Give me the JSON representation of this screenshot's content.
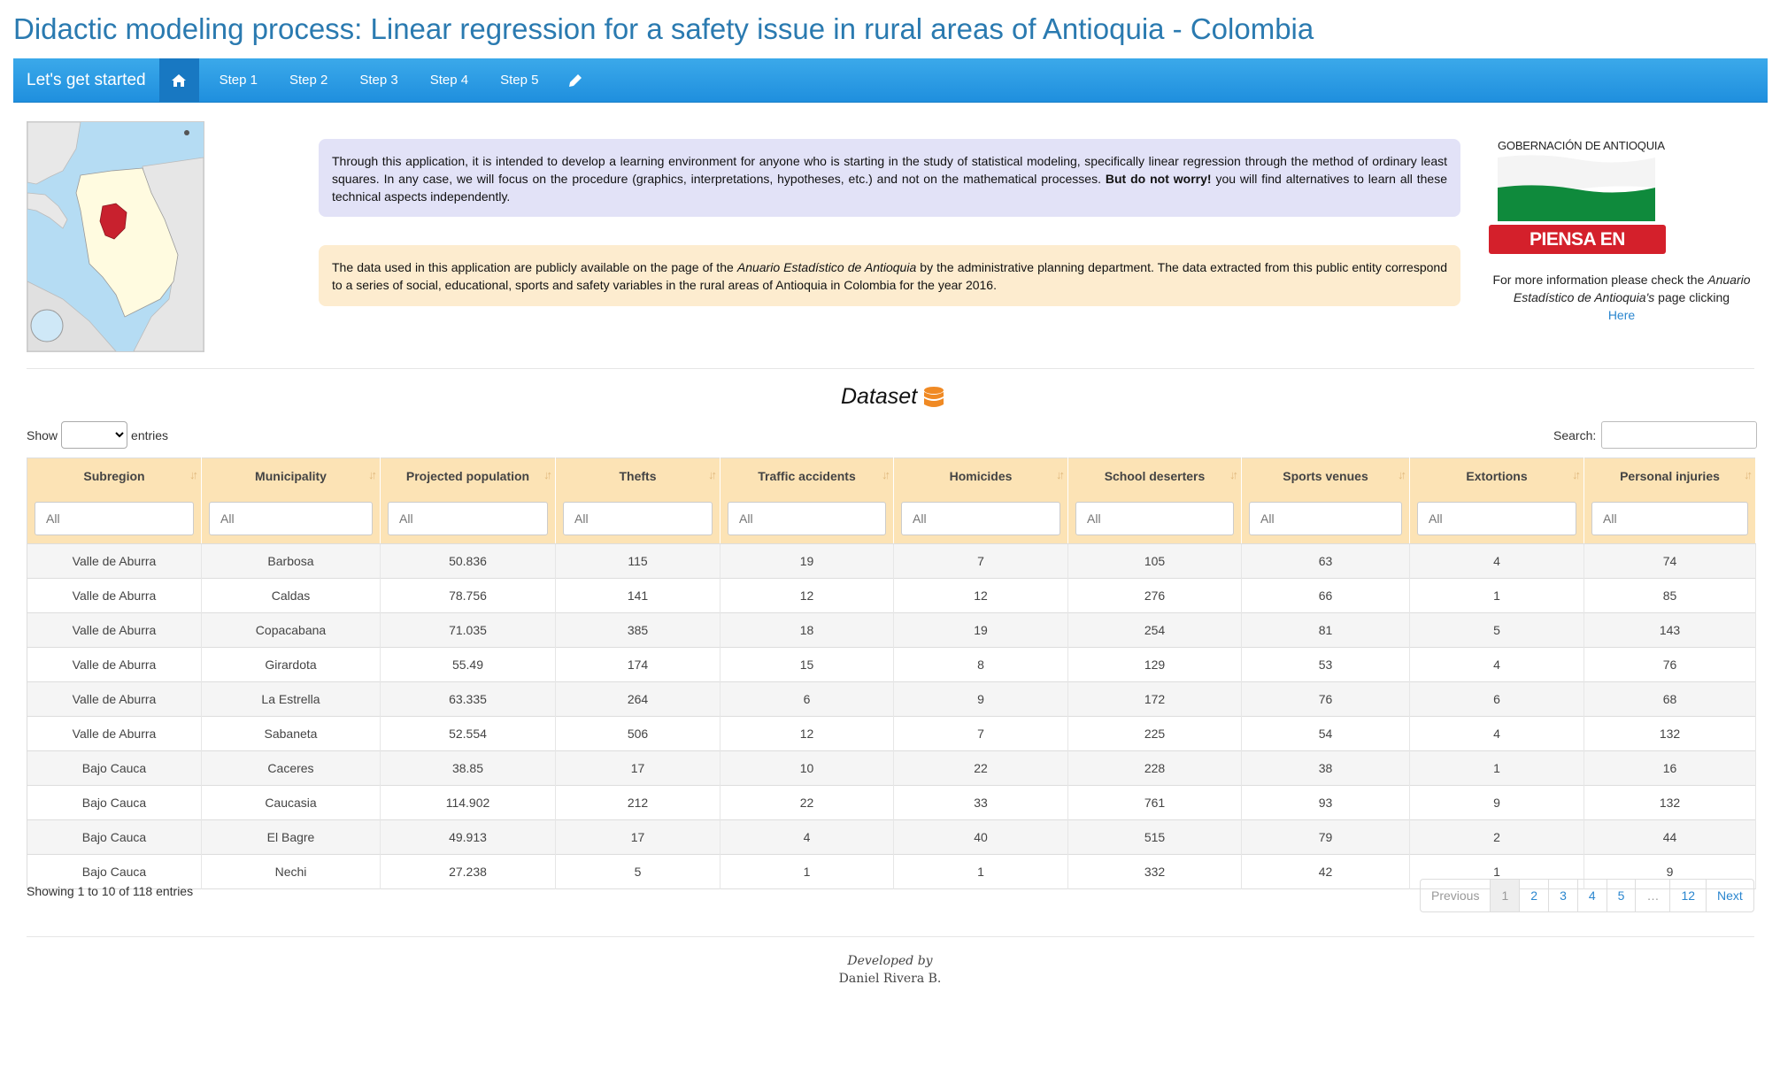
{
  "title": "Didactic modeling process: Linear regression for a safety issue in rural areas of Antioquia - Colombia",
  "navbar": {
    "brand": "Let's get started",
    "items": [
      "Step 1",
      "Step 2",
      "Step 3",
      "Step 4",
      "Step 5"
    ],
    "home_icon": "home-icon",
    "edit_icon": "pencil-icon",
    "color": "#2196e8"
  },
  "intro": {
    "p1_start": "Through this application, it is intended to develop a learning environment for anyone who is starting in the study of statistical modeling, specifically linear regression through the method of ordinary least squares. In any case, we will focus on the procedure (graphics, interpretations, hypotheses, etc.) and not on the mathematical processes. ",
    "p1_bold": "But do not worry!",
    "p1_end": " you will find alternatives to learn all these technical aspects independently.",
    "p2_start": "The data used in this application are publicly available on the page of the ",
    "p2_italic": "Anuario Estadístico de Antioquia",
    "p2_end": " by the administrative planning department. The data extracted from this public entity correspond to a series of social, educational, sports and safety variables in the rural areas of Antioquia in Colombia for the year 2016."
  },
  "logo": {
    "title": "GOBERNACIÓN DE ANTIOQUIA",
    "badge": "PIENSA EN GRANDE"
  },
  "info": {
    "start": "For more information please check the ",
    "italic": "Anuario Estadístico de Antioquia's",
    "end": " page clicking",
    "link": "Here"
  },
  "dataset": {
    "title": "Dataset",
    "icon": "database-icon",
    "show_label": "Show",
    "entries_label": "entries",
    "search_label": "Search:",
    "filter_placeholder": "All",
    "columns": [
      "Subregion",
      "Municipality",
      "Projected population",
      "Thefts",
      "Traffic accidents",
      "Homicides",
      "School deserters",
      "Sports venues",
      "Extortions",
      "Personal injuries"
    ],
    "rows": [
      [
        "Valle de Aburra",
        "Barbosa",
        "50.836",
        "115",
        "19",
        "7",
        "105",
        "63",
        "4",
        "74"
      ],
      [
        "Valle de Aburra",
        "Caldas",
        "78.756",
        "141",
        "12",
        "12",
        "276",
        "66",
        "1",
        "85"
      ],
      [
        "Valle de Aburra",
        "Copacabana",
        "71.035",
        "385",
        "18",
        "19",
        "254",
        "81",
        "5",
        "143"
      ],
      [
        "Valle de Aburra",
        "Girardota",
        "55.49",
        "174",
        "15",
        "8",
        "129",
        "53",
        "4",
        "76"
      ],
      [
        "Valle de Aburra",
        "La Estrella",
        "63.335",
        "264",
        "6",
        "9",
        "172",
        "76",
        "6",
        "68"
      ],
      [
        "Valle de Aburra",
        "Sabaneta",
        "52.554",
        "506",
        "12",
        "7",
        "225",
        "54",
        "4",
        "132"
      ],
      [
        "Bajo Cauca",
        "Caceres",
        "38.85",
        "17",
        "10",
        "22",
        "228",
        "38",
        "1",
        "16"
      ],
      [
        "Bajo Cauca",
        "Caucasia",
        "114.902",
        "212",
        "22",
        "33",
        "761",
        "93",
        "9",
        "132"
      ],
      [
        "Bajo Cauca",
        "El Bagre",
        "49.913",
        "17",
        "4",
        "40",
        "515",
        "79",
        "2",
        "44"
      ],
      [
        "Bajo Cauca",
        "Nechi",
        "27.238",
        "5",
        "1",
        "1",
        "332",
        "42",
        "1",
        "9"
      ]
    ],
    "showing": "Showing 1 to 10 of 118 entries",
    "pagination": [
      "Previous",
      "1",
      "2",
      "3",
      "4",
      "5",
      "…",
      "12",
      "Next"
    ],
    "active_page": "1"
  },
  "footer": {
    "developed_by": "Developed by",
    "author": "Daniel Rivera B."
  }
}
